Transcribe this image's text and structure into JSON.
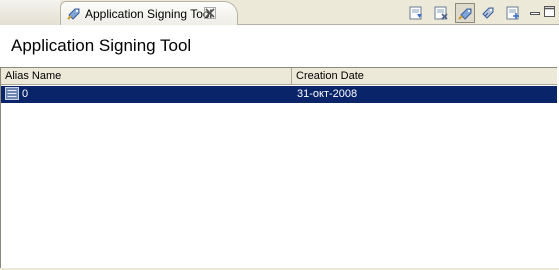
{
  "tab": {
    "label": "Application Signing Tool",
    "icon": "signing-tool-icon",
    "close_icon": "close-icon"
  },
  "toolbar": {
    "buttons": [
      {
        "icon": "import-key-icon"
      },
      {
        "icon": "delete-key-icon"
      },
      {
        "icon": "sign-icon"
      },
      {
        "icon": "sign-all-icon"
      },
      {
        "icon": "export-icon"
      }
    ]
  },
  "window_controls": {
    "minimize_icon": "minimize-icon",
    "maximize_icon": "maximize-icon"
  },
  "page": {
    "title": "Application Signing Tool"
  },
  "table": {
    "columns": [
      "Alias Name",
      "Creation Date"
    ],
    "rows": [
      {
        "alias": "0",
        "date": "31-окт-2008",
        "selected": true
      }
    ]
  },
  "colors": {
    "selection": "#0a246a",
    "chrome": "#ece9d8"
  }
}
